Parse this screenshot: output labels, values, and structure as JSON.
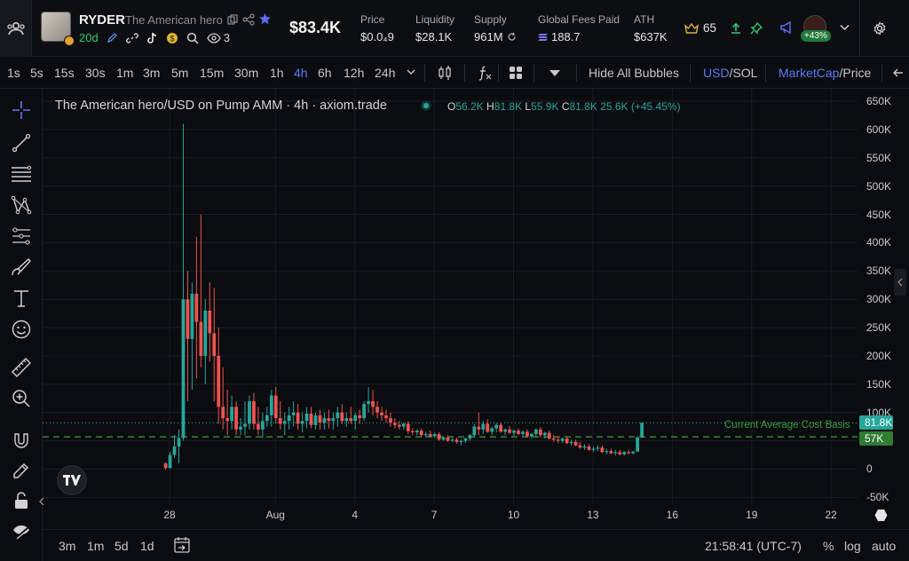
{
  "header": {
    "symbol": "RYDER",
    "name": "The American hero",
    "age": "20d",
    "watchers": "3",
    "price": "$83.4K",
    "stats": [
      {
        "label": "Price",
        "value": "$0.0₄9"
      },
      {
        "label": "Liquidity",
        "value": "$28.1K"
      },
      {
        "label": "Supply",
        "value": "961M"
      },
      {
        "label": "Global Fees Paid",
        "value": "188.7"
      },
      {
        "label": "ATH",
        "value": "$637K"
      }
    ],
    "crown_count": "65",
    "pnl_badge": "+43%"
  },
  "toolbar": {
    "intervals": [
      "1s",
      "5s",
      "15s",
      "30s",
      "1m",
      "3m",
      "5m",
      "15m",
      "30m",
      "1h",
      "4h",
      "6h",
      "12h",
      "24h"
    ],
    "active_interval": "4h",
    "hide_bubbles": "Hide All Bubbles",
    "currency_a": "USD",
    "currency_b": "/SOL",
    "metric_a": "MarketCap",
    "metric_b": "/Price"
  },
  "legend": {
    "title": "The American hero/USD on Pump AMM · 4h · axiom.trade",
    "o_key": "O",
    "o_val": "56.2K",
    "h_key": "H",
    "h_val": "81.8K",
    "l_key": "L",
    "l_val": "55.9K",
    "c_key": "C",
    "c_val": "81.8K",
    "change": "25.6K (+45.45%)"
  },
  "price_tags": {
    "last": "81.8K",
    "cost_basis": "57K",
    "cost_basis_label": "Current Average Cost Basis"
  },
  "chart_data": {
    "type": "candlestick",
    "y_tick_labels": [
      "650K",
      "600K",
      "550K",
      "500K",
      "450K",
      "400K",
      "350K",
      "300K",
      "250K",
      "200K",
      "150K",
      "100K",
      "50K",
      "0",
      "-50K"
    ],
    "y_ticks": [
      650,
      600,
      550,
      500,
      450,
      400,
      350,
      300,
      250,
      200,
      150,
      100,
      50,
      0,
      -50
    ],
    "ylim": [
      -62,
      672
    ],
    "x_tick_labels": [
      "28",
      "Aug",
      "4",
      "7",
      "10",
      "13",
      "16",
      "19",
      "22"
    ],
    "x_ticks_day": [
      28,
      32,
      35,
      38,
      41,
      44,
      47,
      50,
      53
    ],
    "xlim_day": [
      23.2,
      54.0
    ],
    "candles_per_day": 6,
    "first_candle_day": 27.85,
    "reference_lines": [
      {
        "name": "last",
        "value": 81.8,
        "color": "#26a69a",
        "style": "dotted"
      },
      {
        "name": "cost_basis",
        "value": 57,
        "color": "#3f9a3f",
        "style": "dashed"
      }
    ],
    "ohlc_k": [
      [
        10,
        12,
        -1,
        2
      ],
      [
        2,
        30,
        1,
        25
      ],
      [
        25,
        60,
        20,
        40
      ],
      [
        40,
        70,
        10,
        55
      ],
      [
        55,
        610,
        50,
        300
      ],
      [
        300,
        350,
        120,
        230
      ],
      [
        230,
        330,
        140,
        310
      ],
      [
        310,
        410,
        160,
        260
      ],
      [
        260,
        450,
        180,
        200
      ],
      [
        200,
        300,
        150,
        280
      ],
      [
        280,
        330,
        190,
        240
      ],
      [
        240,
        320,
        120,
        200
      ],
      [
        200,
        250,
        80,
        110
      ],
      [
        110,
        180,
        70,
        90
      ],
      [
        90,
        140,
        60,
        85
      ],
      [
        85,
        130,
        70,
        110
      ],
      [
        110,
        120,
        60,
        70
      ],
      [
        70,
        90,
        60,
        75
      ],
      [
        75,
        120,
        60,
        80
      ],
      [
        80,
        130,
        70,
        120
      ],
      [
        120,
        135,
        70,
        80
      ],
      [
        80,
        110,
        60,
        70
      ],
      [
        70,
        100,
        55,
        85
      ],
      [
        85,
        110,
        75,
        95
      ],
      [
        95,
        140,
        75,
        130
      ],
      [
        130,
        145,
        80,
        90
      ],
      [
        90,
        120,
        70,
        80
      ],
      [
        80,
        100,
        60,
        85
      ],
      [
        85,
        110,
        70,
        95
      ],
      [
        95,
        120,
        75,
        100
      ],
      [
        100,
        115,
        70,
        80
      ],
      [
        80,
        100,
        65,
        85
      ],
      [
        85,
        110,
        72,
        98
      ],
      [
        98,
        110,
        72,
        78
      ],
      [
        78,
        100,
        70,
        95
      ],
      [
        95,
        105,
        70,
        82
      ],
      [
        82,
        100,
        70,
        90
      ],
      [
        90,
        105,
        72,
        85
      ],
      [
        85,
        100,
        70,
        90
      ],
      [
        90,
        110,
        75,
        100
      ],
      [
        100,
        115,
        80,
        85
      ],
      [
        85,
        100,
        75,
        90
      ],
      [
        90,
        110,
        80,
        85
      ],
      [
        85,
        100,
        70,
        95
      ],
      [
        95,
        105,
        80,
        90
      ],
      [
        90,
        120,
        85,
        115
      ],
      [
        115,
        145,
        100,
        120
      ],
      [
        120,
        140,
        95,
        110
      ],
      [
        110,
        120,
        90,
        100
      ],
      [
        100,
        110,
        85,
        95
      ],
      [
        95,
        105,
        82,
        90
      ],
      [
        90,
        100,
        75,
        82
      ],
      [
        82,
        90,
        72,
        78
      ],
      [
        78,
        85,
        70,
        75
      ],
      [
        75,
        82,
        70,
        80
      ],
      [
        80,
        85,
        62,
        67
      ],
      [
        67,
        72,
        60,
        65
      ],
      [
        65,
        70,
        60,
        68
      ],
      [
        68,
        72,
        58,
        60
      ],
      [
        60,
        66,
        56,
        62
      ],
      [
        62,
        68,
        56,
        58
      ],
      [
        58,
        64,
        55,
        62
      ],
      [
        62,
        65,
        50,
        52
      ],
      [
        52,
        58,
        50,
        56
      ],
      [
        56,
        60,
        48,
        50
      ],
      [
        50,
        55,
        48,
        52
      ],
      [
        52,
        56,
        45,
        48
      ],
      [
        48,
        52,
        42,
        50
      ],
      [
        50,
        56,
        46,
        54
      ],
      [
        54,
        62,
        50,
        60
      ],
      [
        60,
        80,
        55,
        75
      ],
      [
        75,
        100,
        60,
        70
      ],
      [
        70,
        85,
        62,
        80
      ],
      [
        80,
        88,
        64,
        66
      ],
      [
        66,
        75,
        60,
        72
      ],
      [
        72,
        82,
        65,
        78
      ],
      [
        78,
        82,
        64,
        66
      ],
      [
        66,
        72,
        60,
        70
      ],
      [
        70,
        76,
        62,
        64
      ],
      [
        64,
        70,
        58,
        68
      ],
      [
        68,
        72,
        60,
        62
      ],
      [
        62,
        68,
        58,
        66
      ],
      [
        66,
        70,
        56,
        58
      ],
      [
        58,
        64,
        54,
        62
      ],
      [
        62,
        72,
        58,
        70
      ],
      [
        70,
        74,
        56,
        60
      ],
      [
        60,
        66,
        54,
        64
      ],
      [
        64,
        68,
        52,
        54
      ],
      [
        54,
        60,
        48,
        52
      ],
      [
        52,
        58,
        46,
        50
      ],
      [
        50,
        56,
        46,
        54
      ],
      [
        54,
        58,
        44,
        46
      ],
      [
        46,
        52,
        42,
        48
      ],
      [
        48,
        52,
        40,
        42
      ],
      [
        42,
        48,
        36,
        38
      ],
      [
        38,
        44,
        34,
        40
      ],
      [
        40,
        44,
        32,
        34
      ],
      [
        34,
        40,
        30,
        36
      ],
      [
        36,
        42,
        32,
        38
      ],
      [
        38,
        42,
        28,
        30
      ],
      [
        30,
        36,
        26,
        32
      ],
      [
        32,
        36,
        26,
        28
      ],
      [
        28,
        34,
        24,
        30
      ],
      [
        30,
        34,
        24,
        26
      ],
      [
        26,
        32,
        24,
        30
      ],
      [
        30,
        34,
        26,
        28
      ],
      [
        28,
        32,
        26,
        31
      ],
      [
        31,
        58,
        30,
        56
      ],
      [
        56,
        82,
        55,
        82
      ]
    ]
  },
  "bottombar": {
    "ranges": [
      "3m",
      "1m",
      "5d",
      "1d"
    ],
    "clock": "21:58:41 (UTC-7)",
    "percent": "%",
    "log": "log",
    "auto": "auto"
  }
}
